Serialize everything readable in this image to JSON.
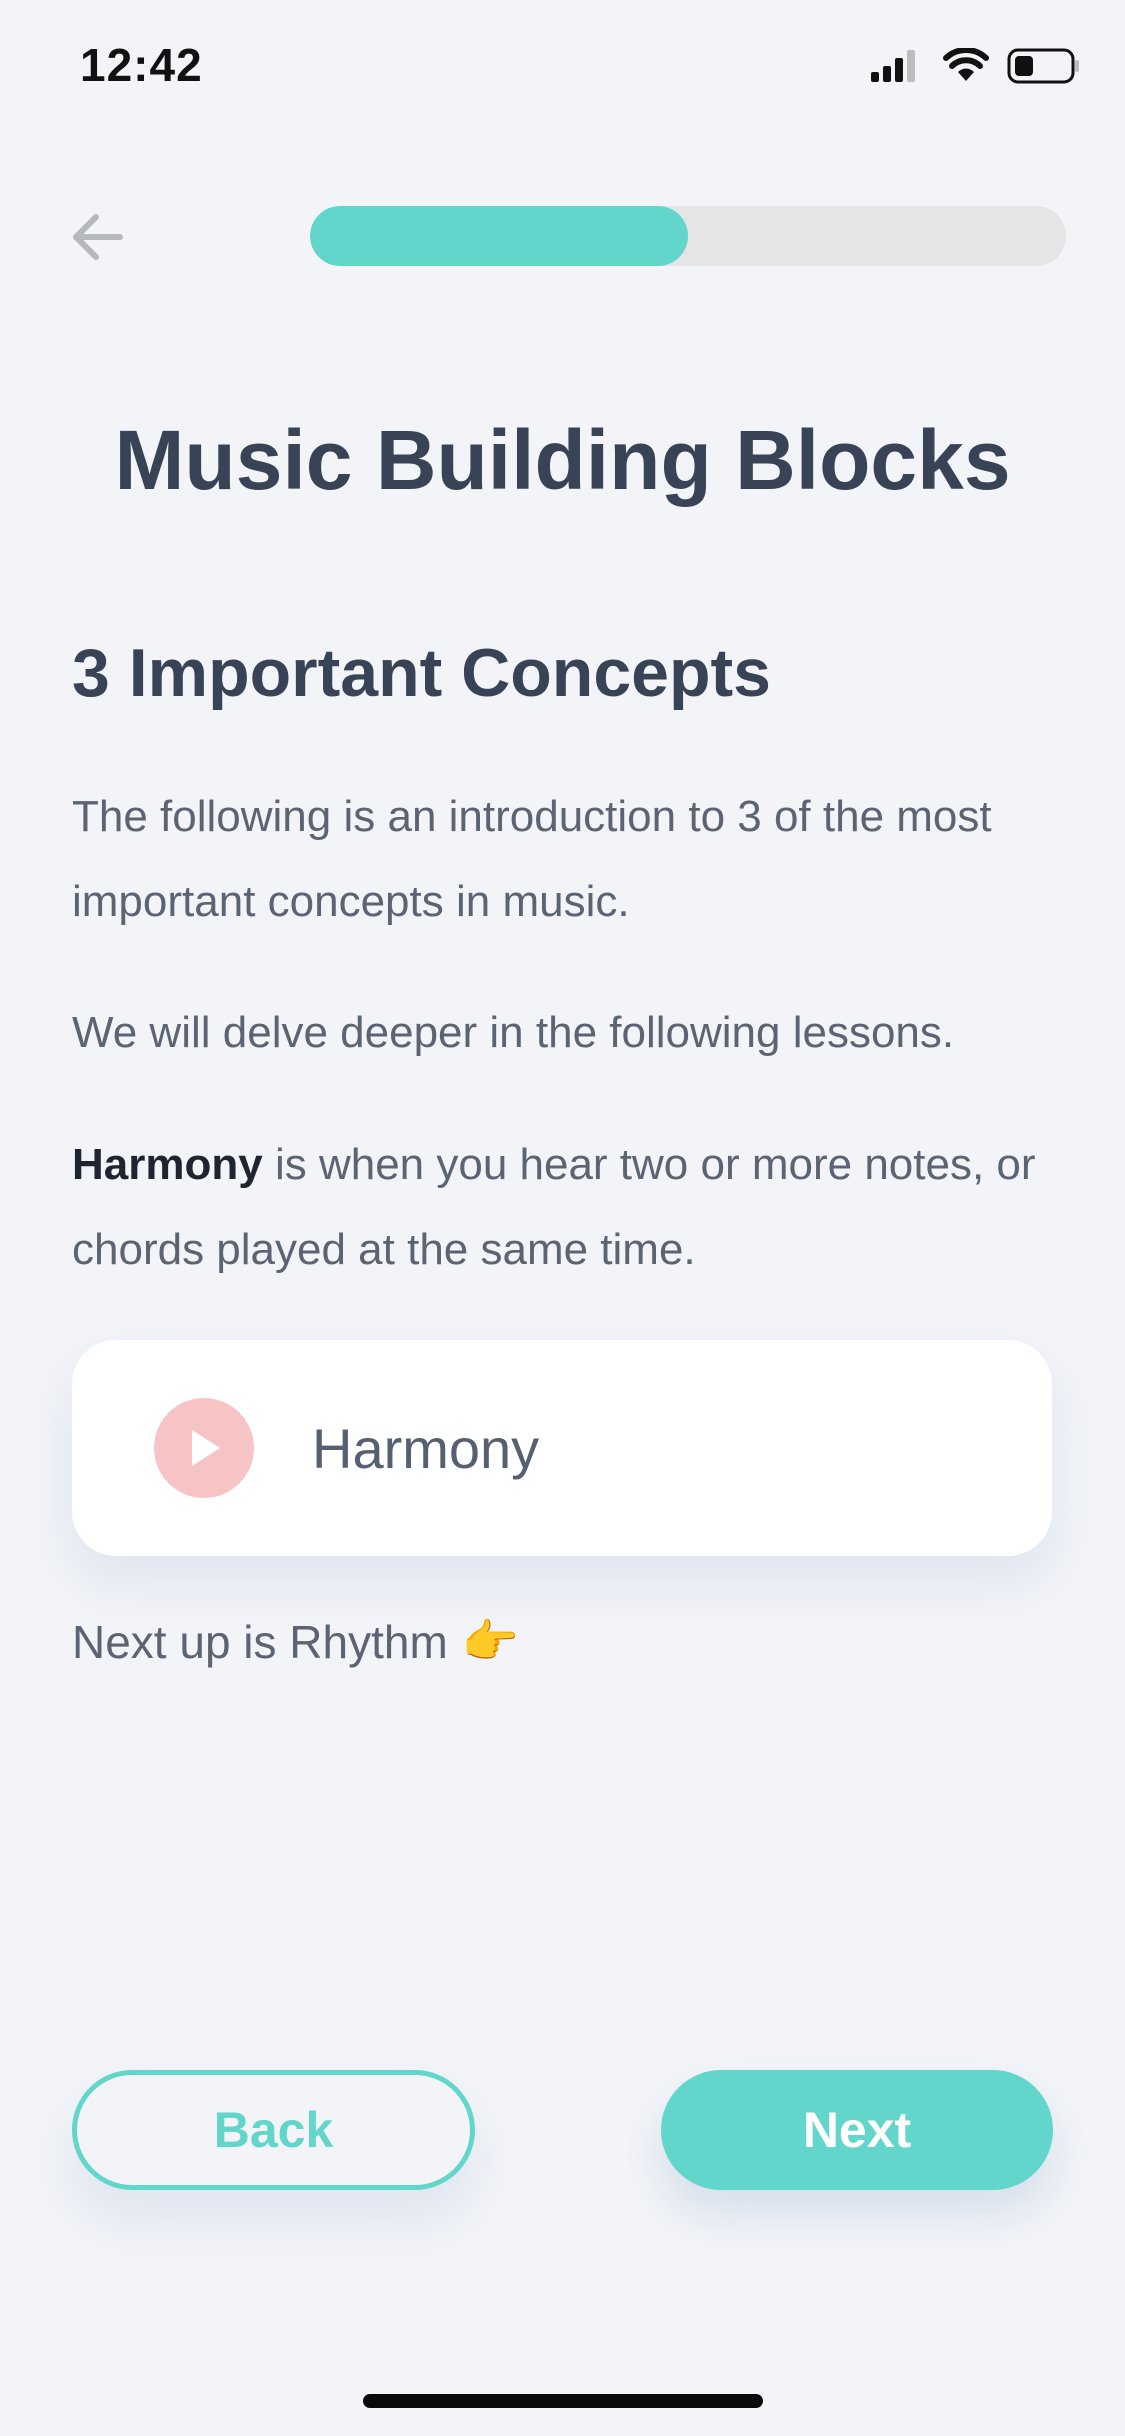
{
  "status_bar": {
    "time": "12:42",
    "icons": [
      "cellular-signal-icon",
      "wifi-icon",
      "battery-icon"
    ]
  },
  "header": {
    "back_icon": "arrow-left-icon",
    "progress": 0.5
  },
  "content": {
    "title": "Music Building Blocks",
    "section_heading": "3 Important Concepts",
    "intro": "The following is an introduction to 3 of the most important concepts in music.",
    "follow_up": "We will delve deeper in the following lessons.",
    "harmony_term": "Harmony",
    "harmony_definition": " is when you hear two or more notes, or chords played at the same time.",
    "audio_card": {
      "icon": "play-icon",
      "label": "Harmony"
    },
    "next_up_text": "Next up is Rhythm",
    "next_up_emoji": "👉"
  },
  "footer": {
    "back_label": "Back",
    "next_label": "Next"
  },
  "colors": {
    "accent": "#62d6cb",
    "background": "#f2f4f8",
    "title": "#384356",
    "body_text": "#5c6473",
    "play_button": "#f6c4c4",
    "progress_track": "#e5e5e5"
  }
}
